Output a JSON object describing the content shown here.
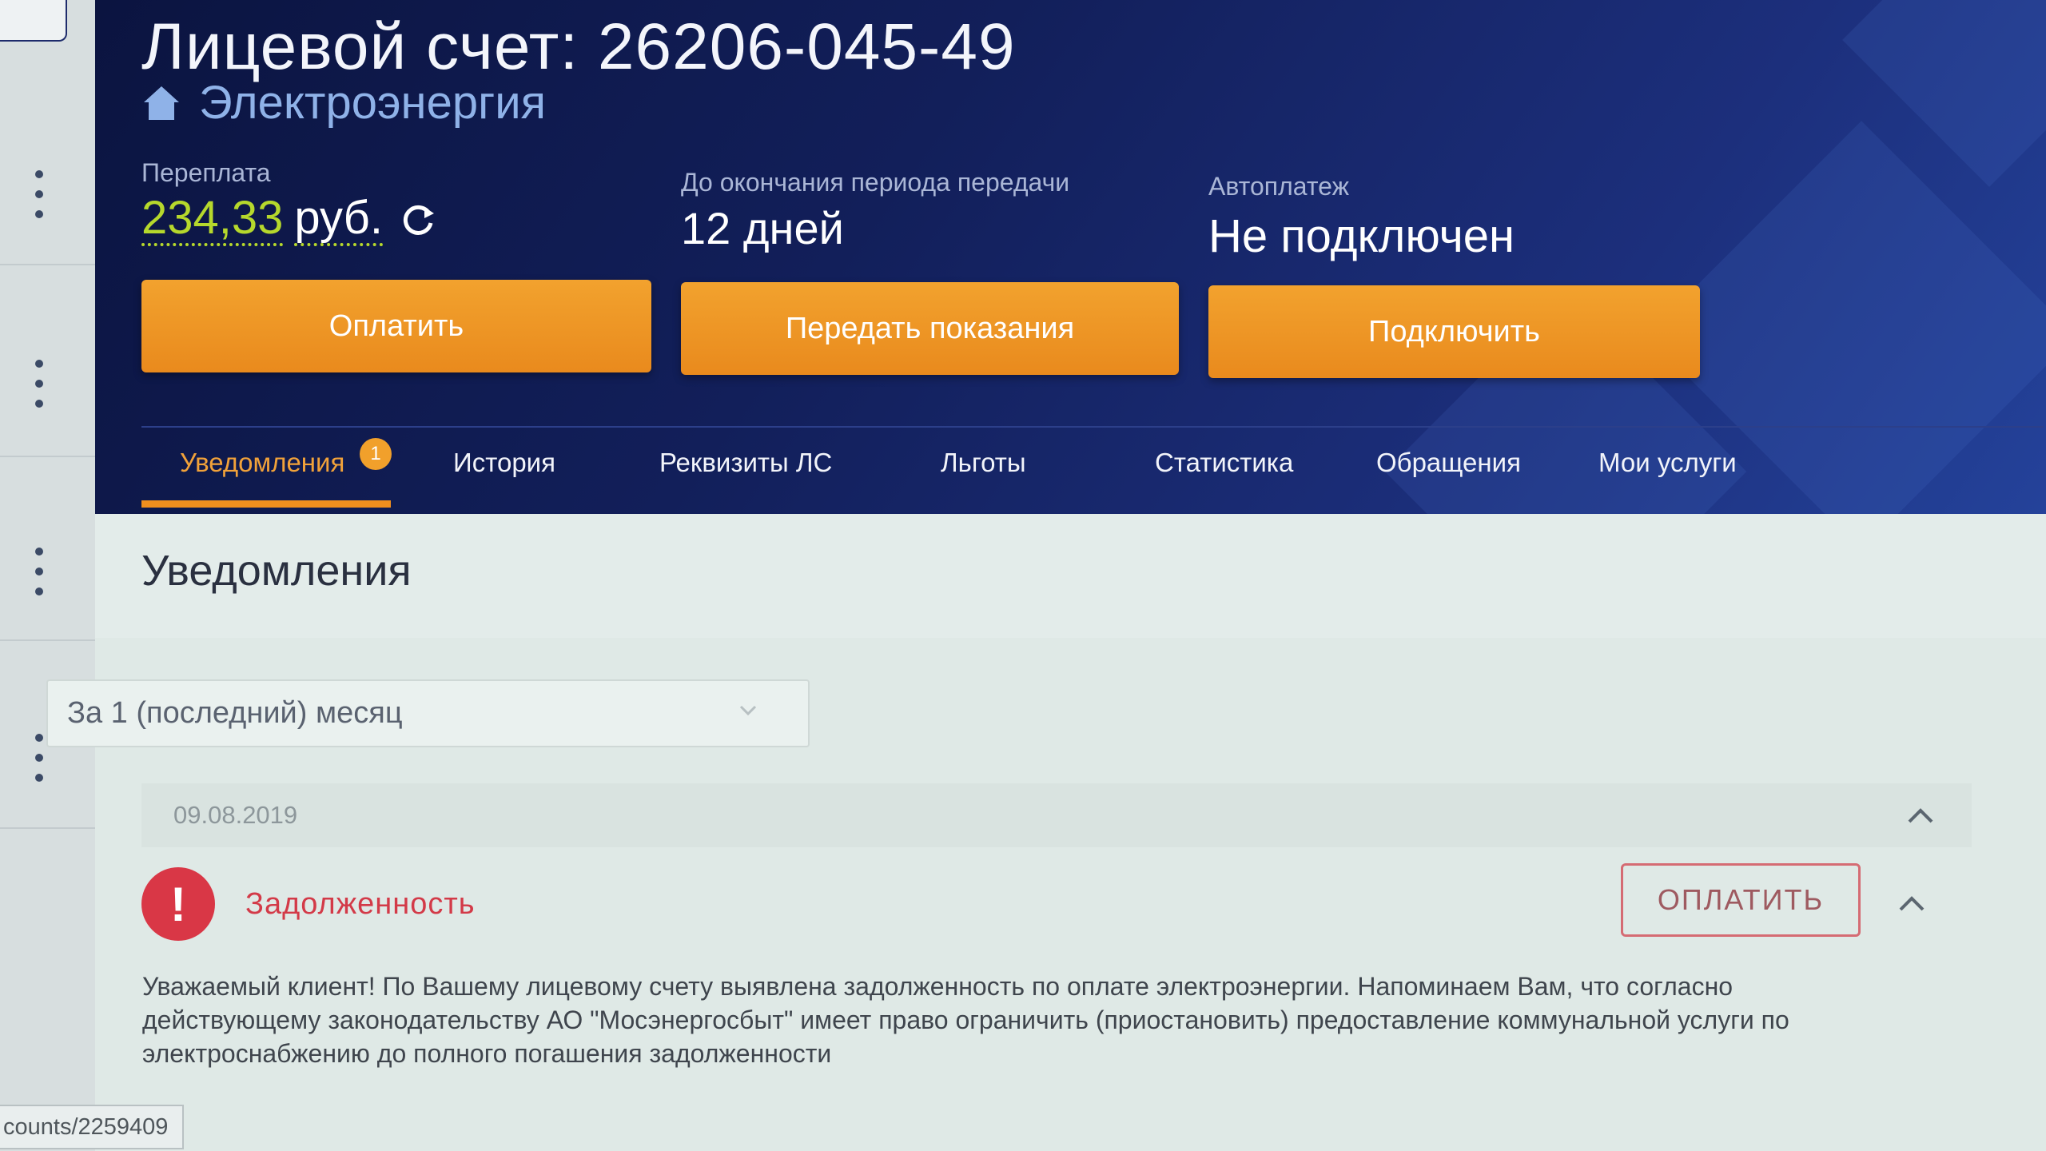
{
  "account": {
    "title": "Лицевой счет: 26206-045-49",
    "service": "Электроэнергия"
  },
  "stats": {
    "balance_label": "Переплата",
    "balance_amount": "234,33",
    "balance_unit": "руб.",
    "period_label": "До окончания периода передачи",
    "period_value": "12 дней",
    "autopay_label": "Автоплатеж",
    "autopay_value": "Не подключен"
  },
  "actions": {
    "pay": "Оплатить",
    "submit_readings": "Передать показания",
    "connect": "Подключить"
  },
  "tabs": [
    {
      "label": "Уведомления",
      "badge": "1",
      "active": true
    },
    {
      "label": "История"
    },
    {
      "label": "Реквизиты ЛС"
    },
    {
      "label": "Льготы"
    },
    {
      "label": "Статистика"
    },
    {
      "label": "Обращения"
    },
    {
      "label": "Мои услуги"
    }
  ],
  "notifications": {
    "title": "Уведомления",
    "filter_value": "За 1 (последний) месяц",
    "date": "09.08.2019",
    "alert_title": "Задолженность",
    "alert_action": "ОПЛАТИТЬ",
    "message": "Уважаемый клиент! По Вашему лицевому счету выявлена задолженность по оплате электроэнергии. Напоминаем Вам, что согласно действующему законодательству АО \"Мосэнергосбыт\" имеет право ограничить (приостановить) предоставление коммунальной услуги по электроснабжению до полного погашения задолженности"
  },
  "status_bar": {
    "url": "counts/2259409"
  },
  "colors": {
    "header_bg": "#121f5a",
    "accent_orange": "#f08f1e",
    "balance_green": "#b6d82c",
    "alert_red": "#d93746"
  },
  "icons": {
    "service": "home-icon",
    "balance_refresh": "refresh-icon",
    "alert": "exclamation-icon",
    "collapse": "chevron-up-icon",
    "filter_select": "chevron-down-icon",
    "rail_menu": "kebab-menu-icon"
  }
}
